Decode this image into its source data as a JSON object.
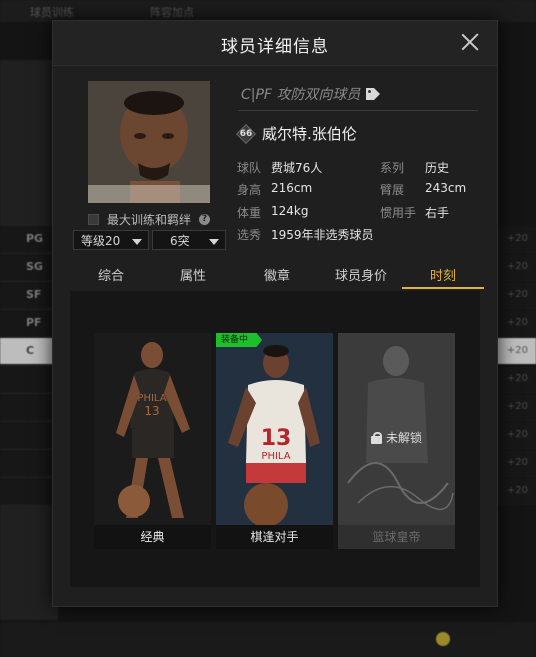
{
  "background": {
    "top_tabs": [
      "球员训练",
      "阵容加点"
    ],
    "positions": [
      "PG",
      "SG",
      "SF",
      "PF",
      "C"
    ],
    "right_values": [
      "+20",
      "+20",
      "+20",
      "+20",
      "+20",
      "+20",
      "+20",
      "+20",
      "+20",
      "+20"
    ]
  },
  "modal": {
    "title": "球员详细信息",
    "close_icon": "close-icon"
  },
  "player": {
    "role": "C|PF 攻防双向球员",
    "number": "66",
    "name": "威尔特.张伯伦",
    "info": [
      {
        "label": "球队",
        "value": "费城76人"
      },
      {
        "label": "系列",
        "value": "历史"
      },
      {
        "label": "身高",
        "value": "216cm"
      },
      {
        "label": "臂展",
        "value": "243cm"
      },
      {
        "label": "体重",
        "value": "124kg"
      },
      {
        "label": "惯用手",
        "value": "右手"
      },
      {
        "label": "选秀",
        "value": "1959年非选秀球员"
      }
    ]
  },
  "training": {
    "label": "最大训练和羁绊",
    "checked": false,
    "level_select": "等级20",
    "breakthrough_select": "6突"
  },
  "tabs": [
    {
      "label": "综合",
      "active": false
    },
    {
      "label": "属性",
      "active": false
    },
    {
      "label": "徽章",
      "active": false
    },
    {
      "label": "球员身价",
      "active": false
    },
    {
      "label": "时刻",
      "active": true
    }
  ],
  "moments": [
    {
      "label": "经典",
      "status": "unlocked"
    },
    {
      "label": "棋逢对手",
      "status": "equipped",
      "badge": "装备中"
    },
    {
      "label": "篮球皇帝",
      "status": "locked",
      "lock_text": "未解锁"
    }
  ],
  "colors": {
    "accent": "#e3b23c",
    "equipped": "#1dbf2a",
    "modal_bg": "#1f1f1f"
  }
}
